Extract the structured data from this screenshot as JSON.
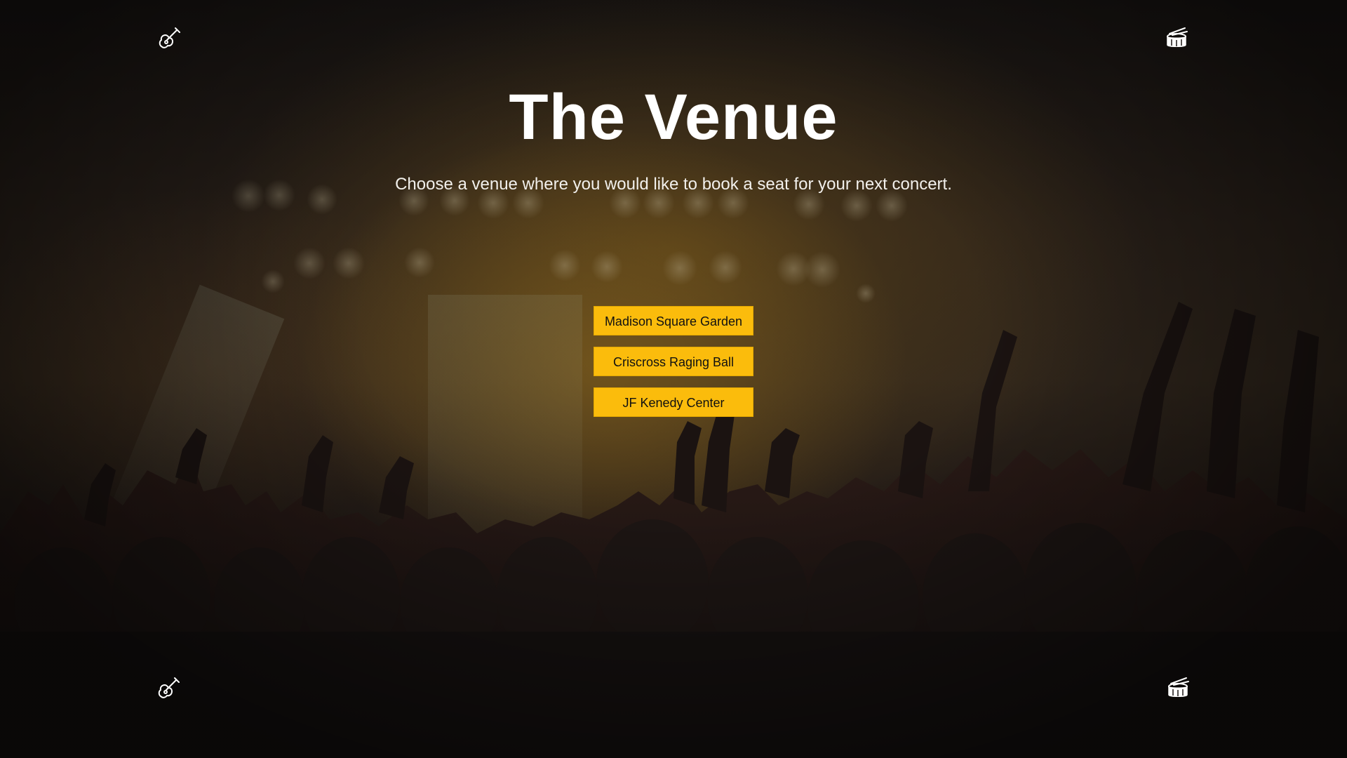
{
  "page": {
    "title": "The Venue",
    "subtitle": "Choose a venue where you would like to book a seat for your next concert."
  },
  "venues": [
    {
      "label": "Madison Square Garden"
    },
    {
      "label": "Criscross Raging Ball"
    },
    {
      "label": "JF Kenedy Center"
    }
  ],
  "icons": {
    "top_left": "guitar-icon",
    "top_right": "drum-icon",
    "bottom_left": "guitar-icon",
    "bottom_right": "drum-icon"
  },
  "colors": {
    "button_bg": "#fbbc0c",
    "button_text": "#111111",
    "title_text": "#ffffff",
    "background": "#1a1614"
  }
}
